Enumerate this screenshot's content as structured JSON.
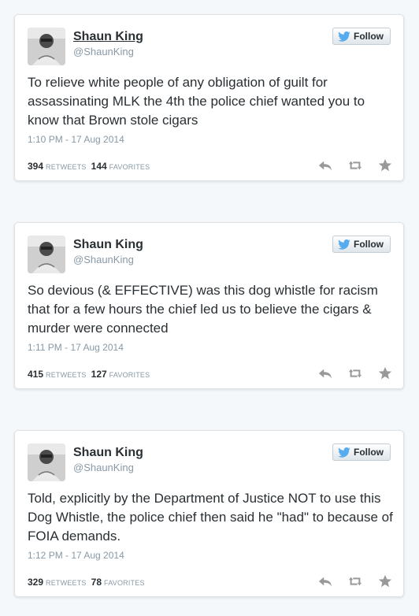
{
  "tweets": [
    {
      "author_name": "Shaun King",
      "handle": "@ShaunKing",
      "follow_label": "Follow",
      "text": "To relieve white people of any obligation of guilt for assassinating MLK the 4th the police chief wanted you to know that Brown stole cigars",
      "timestamp": "1:10 PM - 17 Aug 2014",
      "retweets_count": "394",
      "retweets_label": "RETWEETS",
      "favorites_count": "144",
      "favorites_label": "FAVORITES"
    },
    {
      "author_name": "Shaun King",
      "handle": "@ShaunKing",
      "follow_label": "Follow",
      "text": "So devious (& EFFECTIVE) was this dog whistle for racism that for a few hours the chief led us to believe the cigars & murder were connected",
      "timestamp": "1:11 PM - 17 Aug 2014",
      "retweets_count": "415",
      "retweets_label": "RETWEETS",
      "favorites_count": "127",
      "favorites_label": "FAVORITES"
    },
    {
      "author_name": "Shaun King",
      "handle": "@ShaunKing",
      "follow_label": "Follow",
      "text": "Told, explicitly by the Department of Justice NOT to use this Dog Whistle, the police chief then said he \"had\" to because of FOIA demands.",
      "timestamp": "1:12 PM - 17 Aug 2014",
      "retweets_count": "329",
      "retweets_label": "RETWEETS",
      "favorites_count": "78",
      "favorites_label": "FAVORITES"
    }
  ],
  "icons": {
    "follow": "twitter-bird-icon",
    "reply": "reply-icon",
    "retweet": "retweet-icon",
    "favorite": "star-icon"
  },
  "colors": {
    "brand_blue": "#55acee",
    "text": "#292f33",
    "muted": "#8899a6",
    "action_gray": "#999999"
  }
}
